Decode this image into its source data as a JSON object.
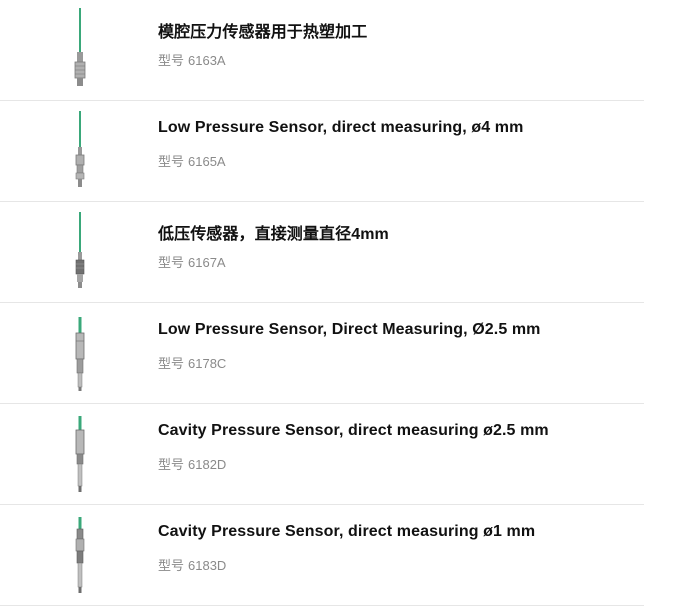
{
  "products": [
    {
      "title": "模腔压力传感器用于热塑加工",
      "model_prefix": "型号",
      "model": "6163A",
      "image": "pressure-sensor-6163a"
    },
    {
      "title": "Low Pressure Sensor, direct measuring, ø4 mm",
      "model_prefix": "型号",
      "model": "6165A",
      "image": "pressure-sensor-6165a"
    },
    {
      "title": "低压传感器，直接测量直径4mm",
      "model_prefix": "型号",
      "model": "6167A",
      "image": "pressure-sensor-6167a"
    },
    {
      "title": "Low Pressure Sensor, Direct Measuring, Ø2.5 mm",
      "model_prefix": "型号",
      "model": "6178C",
      "image": "pressure-sensor-6178c"
    },
    {
      "title": "Cavity Pressure Sensor, direct measuring ø2.5 mm",
      "model_prefix": "型号",
      "model": "6182D",
      "image": "pressure-sensor-6182d"
    },
    {
      "title": "Cavity Pressure Sensor, direct measuring ø1 mm",
      "model_prefix": "型号",
      "model": "6183D",
      "image": "pressure-sensor-6183d"
    }
  ],
  "colors": {
    "cable_green": "#3aa87a",
    "metal": "#8c8c8c",
    "title": "#111111",
    "model": "#8a8a8a",
    "divider": "#e6e6e6"
  }
}
